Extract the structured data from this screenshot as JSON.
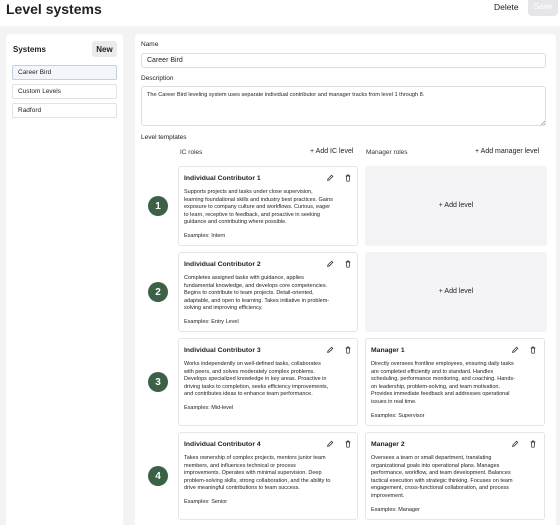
{
  "header": {
    "title": "Level systems",
    "delete_label": "Delete",
    "save_label": "Save"
  },
  "sidebar": {
    "title": "Systems",
    "new_label": "New",
    "items": [
      {
        "label": "Career Bird",
        "active": true
      },
      {
        "label": "Custom Levels",
        "active": false
      },
      {
        "label": "Radford",
        "active": false
      }
    ]
  },
  "form": {
    "name_label": "Name",
    "name_value": "Career Bird",
    "description_label": "Description",
    "description_value": "The Career Bird leveling system uses separate individual contributor and manager tracks from level 1 through 8.",
    "templates_label": "Level templates"
  },
  "columns": {
    "ic_label": "IC roles",
    "add_ic_label": "Add IC level",
    "mgr_label": "Manager roles",
    "add_mgr_label": "Add manager level",
    "add_level_label": "Add level"
  },
  "levels": [
    {
      "number": "1",
      "ic": {
        "title": "Individual Contributor 1",
        "lines": [
          "Supports projects and tasks under close supervision,",
          "learning foundational skills and industry best practices. Gains",
          "exposure to company culture and workflows. Curious, eager",
          "to learn, receptive to feedback, and proactive in seeking",
          "guidance and contributing where possible."
        ],
        "examples": "Examples: Intern"
      }
    },
    {
      "number": "2",
      "ic": {
        "title": "Individual Contributor 2",
        "lines": [
          "Completes assigned tasks with guidance, applies",
          "fundamental knowledge, and develops core competencies.",
          "Begins to contribute to team projects. Detail-oriented,",
          "adaptable, and open to learning. Takes initiative in problem-",
          "solving and improving efficiency."
        ],
        "examples": "Examples: Entry Level"
      }
    },
    {
      "number": "3",
      "ic": {
        "title": "Individual Contributor 3",
        "lines": [
          "Works independently on well-defined tasks, collaborates",
          "with peers, and solves moderately complex problems.",
          "Develops specialized knowledge in key areas. Proactive in",
          "driving tasks to completion, seeks efficiency improvements,",
          "and contributes ideas to enhance team performance."
        ],
        "examples": "Examples: Mid-level"
      },
      "mgr": {
        "title": "Manager 1",
        "lines": [
          "Directly oversees frontline employees, ensuring daily tasks",
          "are completed efficiently and to standard. Handles",
          "scheduling, performance monitoring, and coaching. Hands-",
          "on leadership, problem-solving, and team motivation.",
          "Provides immediate feedback and addresses operational",
          "issues in real time."
        ],
        "examples": "Examples: Supervisor"
      }
    },
    {
      "number": "4",
      "ic": {
        "title": "Individual Contributor 4",
        "lines": [
          "Takes ownership of complex projects, mentors junior team",
          "members, and influences technical or process",
          "improvements. Operates with minimal supervision. Deep",
          "problem-solving skills, strong collaboration, and the ability to",
          "drive meaningful contributions to team success."
        ],
        "examples": "Examples: Senior"
      },
      "mgr": {
        "title": "Manager 2",
        "lines": [
          "Oversees a team or small department, translating",
          "organizational goals into operational plans. Manages",
          "performance, workflow, and team development. Balances",
          "tactical execution with strategic thinking. Focuses on team",
          "engagement, cross-functional collaboration, and process",
          "improvement."
        ],
        "examples": "Examples: Manager"
      }
    }
  ]
}
